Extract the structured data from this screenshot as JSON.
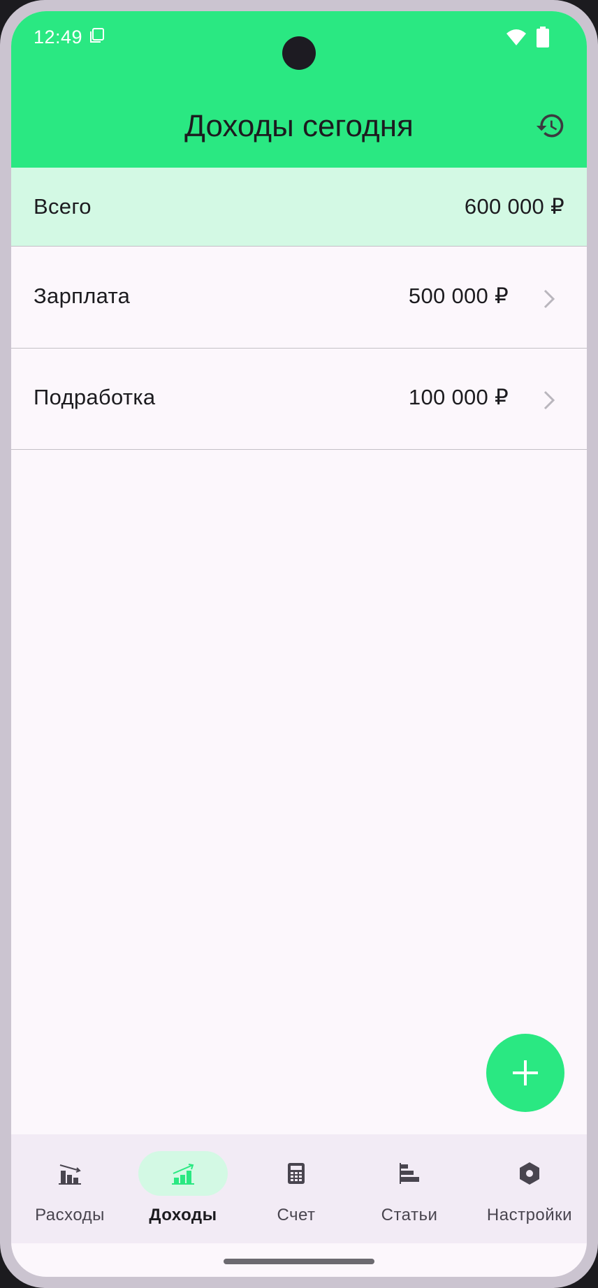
{
  "status_bar": {
    "time": "12:49"
  },
  "header": {
    "title": "Доходы сегодня",
    "history_icon": "history-icon"
  },
  "total": {
    "label": "Всего",
    "amount": "600 000 ₽"
  },
  "incomes": [
    {
      "label": "Зарплата",
      "amount": "500 000 ₽"
    },
    {
      "label": "Подработка",
      "amount": "100 000 ₽"
    }
  ],
  "fab": {
    "icon": "plus-icon"
  },
  "nav": {
    "active": "Доходы",
    "items": [
      {
        "label": "Расходы",
        "icon": "expenses-chart-icon"
      },
      {
        "label": "Доходы",
        "icon": "income-chart-icon"
      },
      {
        "label": "Счет",
        "icon": "calculator-icon"
      },
      {
        "label": "Статьи",
        "icon": "articles-icon"
      },
      {
        "label": "Настройки",
        "icon": "settings-icon"
      }
    ]
  },
  "colors": {
    "accent": "#2ae882",
    "accent_light": "#d3f9e4",
    "background": "#fcf7fc",
    "nav_background": "#f2ebf5",
    "text": "#1c1b1f"
  }
}
